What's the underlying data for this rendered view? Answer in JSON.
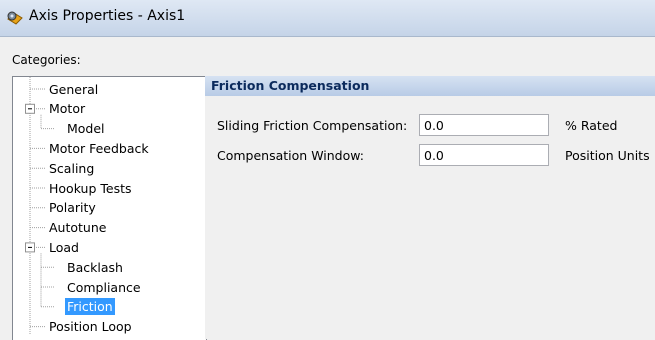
{
  "window": {
    "title": "Axis Properties - Axis1",
    "icon": "gear-icon"
  },
  "categories_label": "Categories:",
  "tree": {
    "items": [
      {
        "label": "General",
        "level": 0,
        "expander": "none",
        "selected": false
      },
      {
        "label": "Motor",
        "level": 0,
        "expander": "minus",
        "selected": false
      },
      {
        "label": "Model",
        "level": 1,
        "expander": "none",
        "selected": false
      },
      {
        "label": "Motor Feedback",
        "level": 0,
        "expander": "none",
        "selected": false
      },
      {
        "label": "Scaling",
        "level": 0,
        "expander": "none",
        "selected": false
      },
      {
        "label": "Hookup Tests",
        "level": 0,
        "expander": "none",
        "selected": false
      },
      {
        "label": "Polarity",
        "level": 0,
        "expander": "none",
        "selected": false
      },
      {
        "label": "Autotune",
        "level": 0,
        "expander": "none",
        "selected": false
      },
      {
        "label": "Load",
        "level": 0,
        "expander": "minus",
        "selected": false
      },
      {
        "label": "Backlash",
        "level": 1,
        "expander": "none",
        "selected": false
      },
      {
        "label": "Compliance",
        "level": 1,
        "expander": "none",
        "selected": false
      },
      {
        "label": "Friction",
        "level": 1,
        "expander": "none",
        "selected": true
      },
      {
        "label": "Position Loop",
        "level": 0,
        "expander": "none",
        "selected": false
      }
    ]
  },
  "panel": {
    "title": "Friction Compensation",
    "fields": [
      {
        "label": "Sliding Friction Compensation:",
        "value": "0.0",
        "unit": "% Rated"
      },
      {
        "label": "Compensation Window:",
        "value": "0.0",
        "unit": "Position Units"
      }
    ]
  },
  "colors": {
    "selection": "#3399ff",
    "panel_header": "#c8d8ee",
    "window_bg": "#f0f0f0"
  }
}
